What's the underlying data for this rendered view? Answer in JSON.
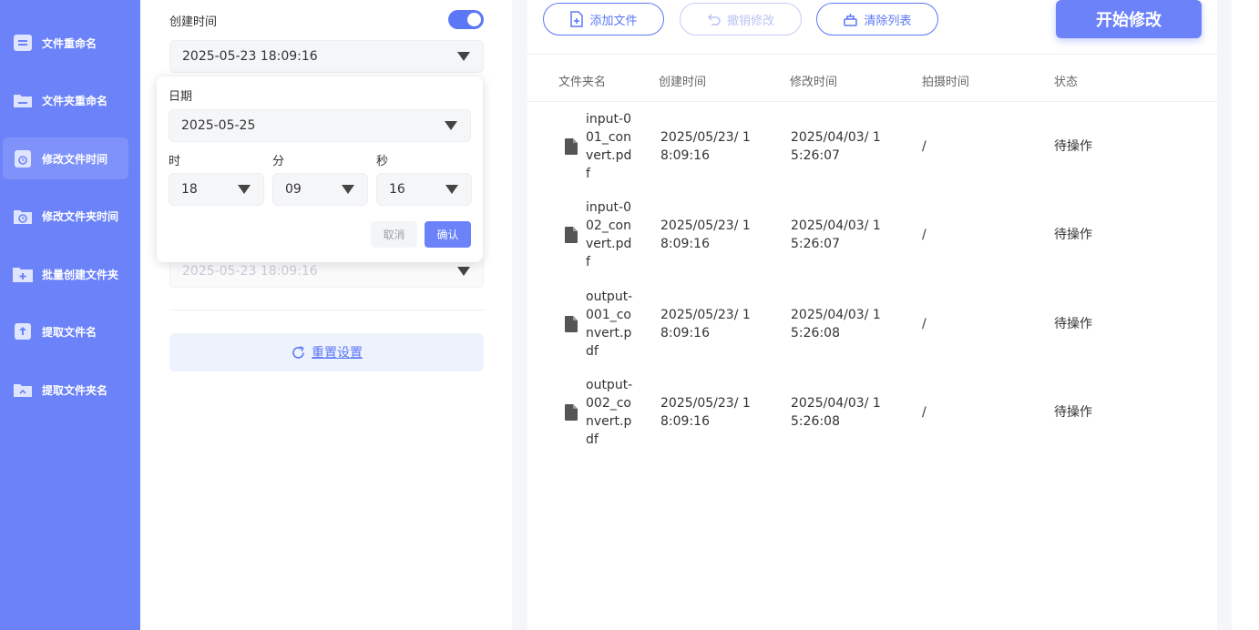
{
  "sidebar": {
    "items": [
      {
        "label": "文件重命名",
        "icon": "file-lines-icon"
      },
      {
        "label": "文件夹重命名",
        "icon": "folder-icon"
      },
      {
        "label": "修改文件时间",
        "icon": "file-clock-icon"
      },
      {
        "label": "修改文件夹时间",
        "icon": "folder-clock-icon"
      },
      {
        "label": "批量创建文件夹",
        "icon": "folder-plus-icon"
      },
      {
        "label": "提取文件名",
        "icon": "file-upload-icon"
      },
      {
        "label": "提取文件夹名",
        "icon": "folder-up-icon"
      }
    ],
    "active_index": 2
  },
  "settings": {
    "create_time_label": "创建时间",
    "create_time_enabled": true,
    "create_time_value": "2025-05-23 18:09:16",
    "hidden_time_value": "2025-05-23 18:09:16",
    "reset_label": "重置设置"
  },
  "picker": {
    "date_label": "日期",
    "date_value": "2025-05-25",
    "hour_label": "时",
    "minute_label": "分",
    "second_label": "秒",
    "hour_value": "18",
    "minute_value": "09",
    "second_value": "16",
    "cancel_label": "取消",
    "ok_label": "确认"
  },
  "toolbar": {
    "add_label": "添加文件",
    "undo_label": "撤销修改",
    "clear_label": "清除列表",
    "start_label": "开始修改"
  },
  "table": {
    "columns": [
      "文件夹名",
      "创建时间",
      "修改时间",
      "拍摄时间",
      "状态"
    ],
    "rows": [
      {
        "name": "input-001_convert.pdf",
        "ctime": "2025/05/23/ 18:09:16",
        "mtime": "2025/04/03/ 15:26:07",
        "ptime": "/",
        "status": "待操作"
      },
      {
        "name": "input-002_convert.pdf",
        "ctime": "2025/05/23/ 18:09:16",
        "mtime": "2025/04/03/ 15:26:07",
        "ptime": "/",
        "status": "待操作"
      },
      {
        "name": "output-001_convert.pdf",
        "ctime": "2025/05/23/ 18:09:16",
        "mtime": "2025/04/03/ 15:26:08",
        "ptime": "/",
        "status": "待操作"
      },
      {
        "name": "output-002_convert.pdf",
        "ctime": "2025/05/23/ 18:09:16",
        "mtime": "2025/04/03/ 15:26:08",
        "ptime": "/",
        "status": "待操作"
      }
    ]
  },
  "colors": {
    "sidebar": "#6b82f9",
    "accent": "#5b77f5"
  }
}
